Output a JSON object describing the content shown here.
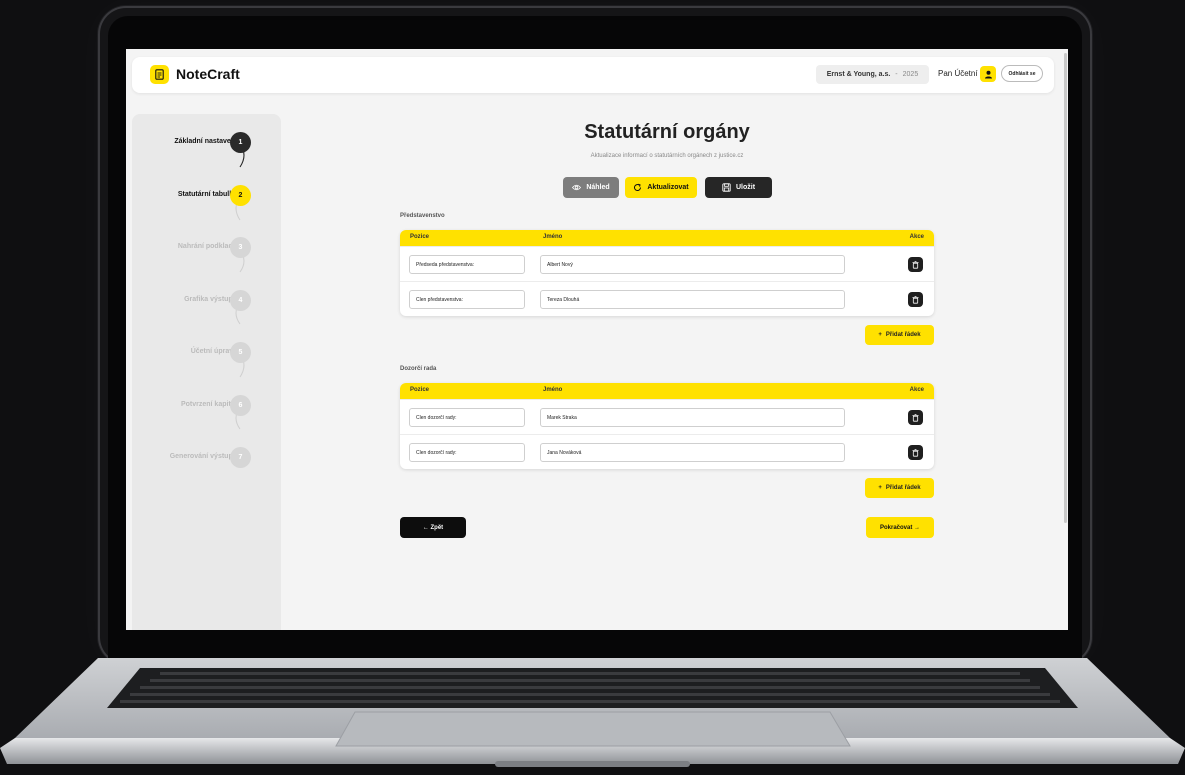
{
  "header": {
    "app_name": "NoteCraft",
    "company": "Ernst & Young, a.s.",
    "separator": "-",
    "year": "2025",
    "user_name": "Pan Účetní",
    "logout_label": "Odhlásit se"
  },
  "steps": [
    {
      "label": "Základní nastavení",
      "number": "1",
      "state": "done"
    },
    {
      "label": "Statutární tabulky",
      "number": "2",
      "state": "active"
    },
    {
      "label": "Nahrání podkladů",
      "number": "3",
      "state": "todo"
    },
    {
      "label": "Grafika výstupů",
      "number": "4",
      "state": "todo"
    },
    {
      "label": "Účetní úpravy",
      "number": "5",
      "state": "todo"
    },
    {
      "label": "Potvrzení kapitol",
      "number": "6",
      "state": "todo"
    },
    {
      "label": "Generování výstupů",
      "number": "7",
      "state": "todo"
    }
  ],
  "page": {
    "title": "Statutární orgány",
    "subtitle": "Aktualizace informací o statutárních orgánech z justice.cz"
  },
  "actions": {
    "preview_label": "Náhled",
    "refresh_label": "Aktualizovat",
    "save_label": "Uložit"
  },
  "table_headers": {
    "position": "Pozice",
    "name": "Jméno",
    "actions": "Akce"
  },
  "board": {
    "title": "Představenstvo",
    "rows": [
      {
        "position": "Předseda představenstva:",
        "name": "Albert Nový"
      },
      {
        "position": "Člen představenstva:",
        "name": "Tereza Dlouhá"
      }
    ],
    "add_label": "Přidat řádek"
  },
  "supervisory": {
    "title": "Dozorčí rada",
    "rows": [
      {
        "position": "Člen dozorčí rady:",
        "name": "Marek Straka"
      },
      {
        "position": "Člen dozorčí rady:",
        "name": "Jana Nováková"
      }
    ],
    "add_label": "Přidat řádek"
  },
  "nav": {
    "back_label": "← Zpět",
    "next_label": "Pokračovat →"
  },
  "colors": {
    "accent": "#ffe100",
    "dark": "#262626",
    "gray_button": "#7d7d7d"
  }
}
